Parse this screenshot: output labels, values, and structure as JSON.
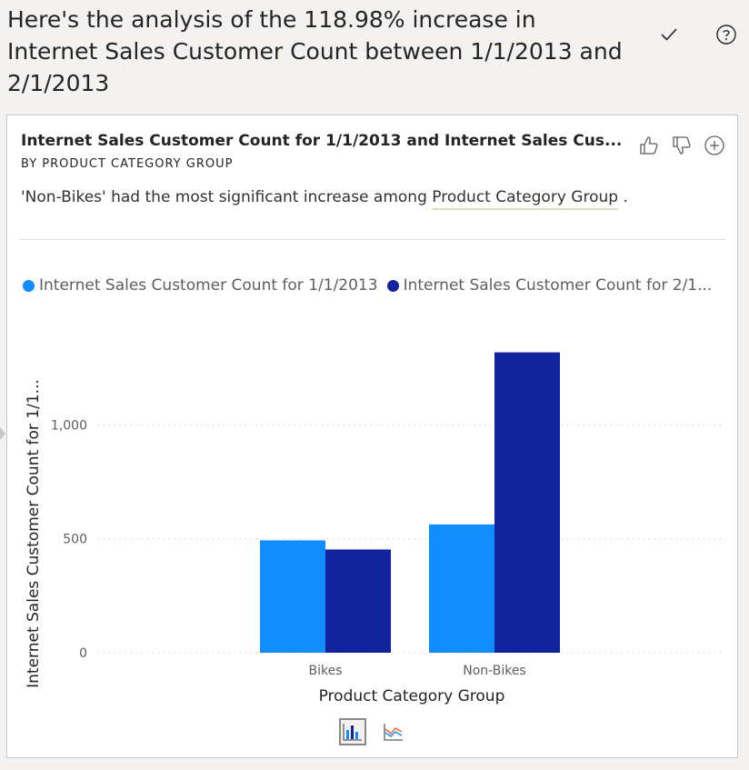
{
  "header": {
    "title": "Here's the analysis of the 118.98% increase in Internet Sales Customer Count between 1/1/2013 and 2/1/2013",
    "check_icon": "check-icon",
    "help_icon": "help-icon"
  },
  "card": {
    "title": "Internet Sales Customer Count for 1/1/2013 and Internet Sales Cus...",
    "subtitle": "BY PRODUCT CATEGORY GROUP",
    "insight_prefix": "'Non-Bikes' had the most significant increase among ",
    "insight_link": "Product Category Group",
    "insight_suffix": ".",
    "actions": [
      "thumbs-up-icon",
      "thumbs-down-icon",
      "add-icon"
    ]
  },
  "legend": {
    "items": [
      {
        "label": "Internet Sales Customer Count for 1/1/2013",
        "color": "#118dff"
      },
      {
        "label": "Internet Sales Customer Count for 2/1...",
        "color": "#12239e"
      }
    ]
  },
  "chart_data": {
    "type": "bar",
    "categories": [
      "Bikes",
      "Non-Bikes"
    ],
    "series": [
      {
        "name": "Internet Sales Customer Count for 1/1/2013",
        "values": [
          493,
          563
        ],
        "color": "#118dff"
      },
      {
        "name": "Internet Sales Customer Count for 2/1...",
        "values": [
          453,
          1318
        ],
        "color": "#12239e"
      }
    ],
    "xlabel": "Product Category Group",
    "ylabel": "Internet Sales Customer Count for 1/1...",
    "yticks": [
      "0",
      "500",
      "1,000"
    ],
    "ylim": [
      0,
      1400
    ],
    "grid": true
  },
  "view_toggle": {
    "bar_icon": "bar-chart-icon",
    "line_icon": "line-chart-icon"
  }
}
